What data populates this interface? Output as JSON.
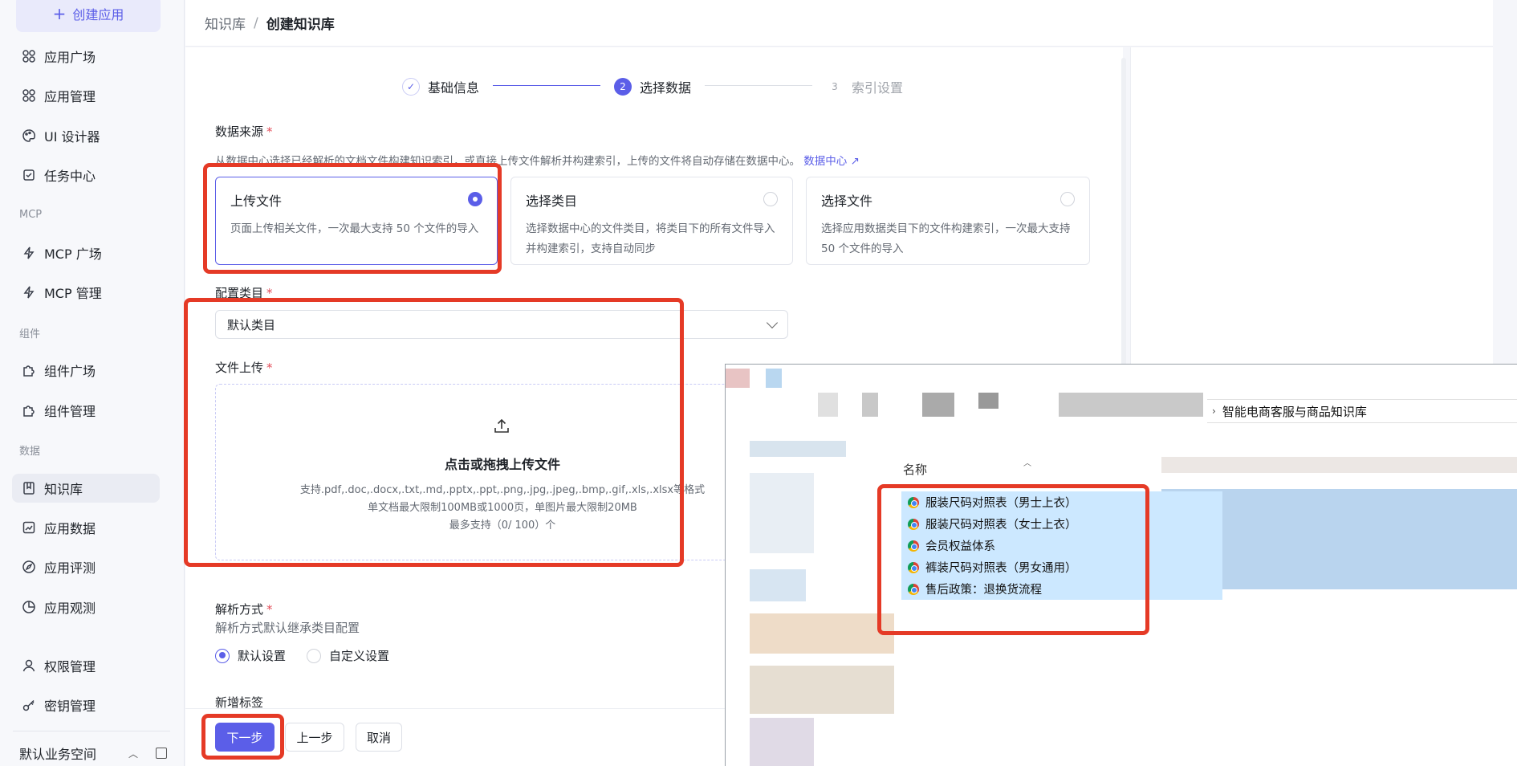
{
  "sidebar": {
    "create_label": "创建应用",
    "items": [
      {
        "label": "应用广场",
        "icon": "grid-icon"
      },
      {
        "label": "应用管理",
        "icon": "grid-icon"
      },
      {
        "label": "UI 设计器",
        "icon": "palette-icon"
      },
      {
        "label": "任务中心",
        "icon": "task-icon"
      },
      {
        "label": "MCP 广场",
        "icon": "lightning-icon"
      },
      {
        "label": "MCP 管理",
        "icon": "lightning-icon"
      },
      {
        "label": "组件广场",
        "icon": "puzzle-icon"
      },
      {
        "label": "组件管理",
        "icon": "puzzle-icon"
      },
      {
        "label": "知识库",
        "icon": "book-icon"
      },
      {
        "label": "应用数据",
        "icon": "chart-icon"
      },
      {
        "label": "应用评测",
        "icon": "compass-icon"
      },
      {
        "label": "应用观测",
        "icon": "pie-icon"
      },
      {
        "label": "权限管理",
        "icon": "user-icon"
      },
      {
        "label": "密钥管理",
        "icon": "key-icon"
      }
    ],
    "groups": [
      "MCP",
      "组件",
      "数据"
    ],
    "workspace": "默认业务空间"
  },
  "header": {
    "crumb_parent": "知识库",
    "separator": "/",
    "crumb_current": "创建知识库"
  },
  "steps": [
    {
      "num": "✓",
      "label": "基础信息"
    },
    {
      "num": "2",
      "label": "选择数据"
    },
    {
      "num": "3",
      "label": "索引设置"
    }
  ],
  "form": {
    "source_label": "数据来源",
    "required_mark": "*",
    "source_desc": "从数据中心选择已经解析的文档文件构建知识索引，或直接上传文件解析并构建索引，上传的文件将自动存储在数据中心。",
    "source_link": "数据中心",
    "sources": [
      {
        "title": "上传文件",
        "desc": "页面上传相关文件，一次最大支持 50 个文件的导入"
      },
      {
        "title": "选择类目",
        "desc": "选择数据中心的文件类目，将类目下的所有文件导入并构建索引，支持自动同步"
      },
      {
        "title": "选择文件",
        "desc": "选择应用数据类目下的文件构建索引，一次最大支持 50 个文件的导入"
      }
    ],
    "category_label": "配置类目",
    "category_value": "默认类目",
    "upload_label": "文件上传",
    "upload_title": "点击或拖拽上传文件",
    "upload_formats": "支持.pdf,.doc,.docx,.txt,.md,.pptx,.ppt,.png,.jpg,.jpeg,.bmp,.gif,.xls,.xlsx等格式",
    "upload_limit": "单文档最大限制100MB或1000页，单图片最大限制20MB",
    "upload_count": "最多支持（0/ 100）个",
    "parse_label": "解析方式",
    "parse_desc": "解析方式默认继承类目配置",
    "parse_default": "默认设置",
    "parse_custom": "自定义设置",
    "tag_label": "新增标签"
  },
  "buttons": {
    "next": "下一步",
    "prev": "上一步",
    "cancel": "取消"
  },
  "explorer": {
    "path": "智能电商客服与商品知识库",
    "column_name": "名称",
    "files": [
      "服装尺码对照表（男士上衣）",
      "服装尺码对照表（女士上衣）",
      "会员权益体系",
      "裤装尺码对照表（男女通用）",
      "售后政策：退换货流程"
    ]
  },
  "colors": {
    "accent": "#5b5ee8",
    "annotation": "#e53a26",
    "selection": "#cce8ff"
  }
}
